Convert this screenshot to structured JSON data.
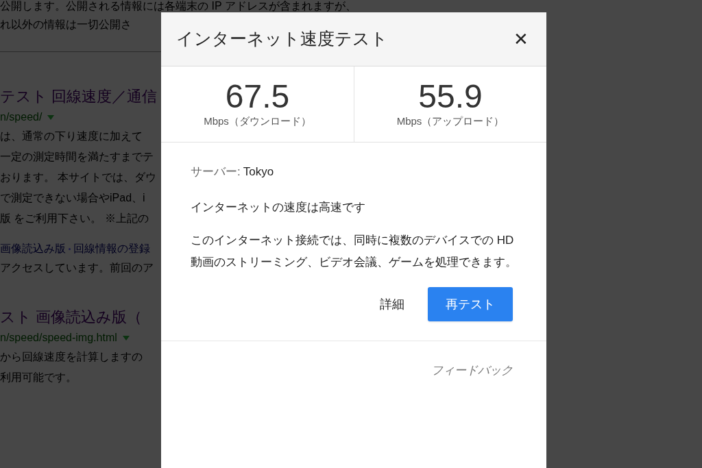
{
  "background": {
    "lines": [
      {
        "kind": "text",
        "text": "公開します。公開される情報には各端末の IP アドレスが含まれますが、"
      },
      {
        "kind": "text",
        "text": "れ以外の情報は一切公開さ"
      },
      {
        "kind": "rule"
      },
      {
        "kind": "title",
        "text": "テスト 回線速度／通信"
      },
      {
        "kind": "url",
        "text": "n/speed/"
      },
      {
        "kind": "text",
        "text": "は、通常の下り速度に加えて"
      },
      {
        "kind": "text",
        "text": "一定の測定時間を満たすまでテ"
      },
      {
        "kind": "text",
        "text": "おります。 本サイトでは、ダウ"
      },
      {
        "kind": "text",
        "text": "で測定できない場合やiPad、i"
      },
      {
        "kind": "text",
        "text": "版 をご利用下さい。 ※上記の"
      },
      {
        "kind": "gap"
      },
      {
        "kind": "links",
        "items": [
          "画像読込み版",
          "回線情報の登録"
        ]
      },
      {
        "kind": "text",
        "text": "アクセスしています。前回のア"
      },
      {
        "kind": "gap"
      },
      {
        "kind": "title",
        "text": "スト 画像読込み版（"
      },
      {
        "kind": "url",
        "text": "n/speed/speed-img.html"
      },
      {
        "kind": "text",
        "text": "から回線速度を計算しますの"
      },
      {
        "kind": "text",
        "text": "利用可能です。"
      }
    ]
  },
  "dialog": {
    "title": "インターネット速度テスト",
    "close": "✕",
    "stats": [
      {
        "value": "67.5",
        "unit": "Mbps（ダウンロード）"
      },
      {
        "value": "55.9",
        "unit": "Mbps（アップロード）"
      }
    ],
    "server_label": "サーバー:",
    "server": "Tokyo",
    "verdict": "インターネットの速度は高速です",
    "description": "このインターネット接続では、同時に複数のデバイスでの HD 動画のストリーミング、ビデオ会議、ゲームを処理できます。",
    "buttons": [
      {
        "kind": "text",
        "label": "詳細"
      },
      {
        "kind": "primary",
        "label": "再テスト"
      }
    ],
    "feedback": "フィードバック"
  }
}
